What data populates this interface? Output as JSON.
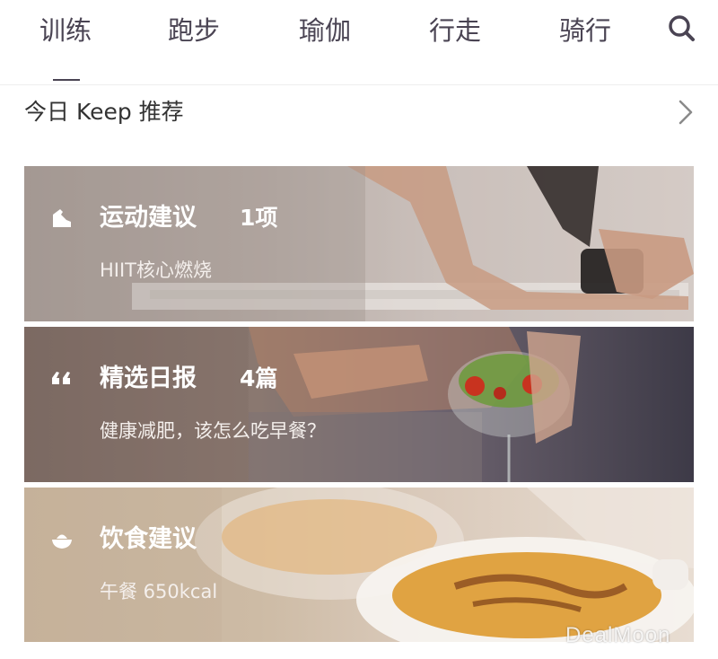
{
  "tabs": [
    {
      "label": "训练",
      "active": true
    },
    {
      "label": "跑步",
      "active": false
    },
    {
      "label": "瑜伽",
      "active": false
    },
    {
      "label": "行走",
      "active": false
    },
    {
      "label": "骑行",
      "active": false
    }
  ],
  "section": {
    "title": "今日 Keep 推荐"
  },
  "cards": [
    {
      "icon": "shoe-icon",
      "title": "运动建议",
      "count": "1项",
      "subtitle": "HIIT核心燃烧"
    },
    {
      "icon": "quote-icon",
      "title": "精选日报",
      "count": "4篇",
      "subtitle": "健康减肥，该怎么吃早餐？"
    },
    {
      "icon": "bowl-icon",
      "title": "饮食建议",
      "count": "",
      "subtitle": "午餐 650kcal"
    }
  ],
  "watermark": "DealMoon",
  "colors": {
    "tab_text": "#4a4453",
    "card_text": "#ffffff"
  }
}
